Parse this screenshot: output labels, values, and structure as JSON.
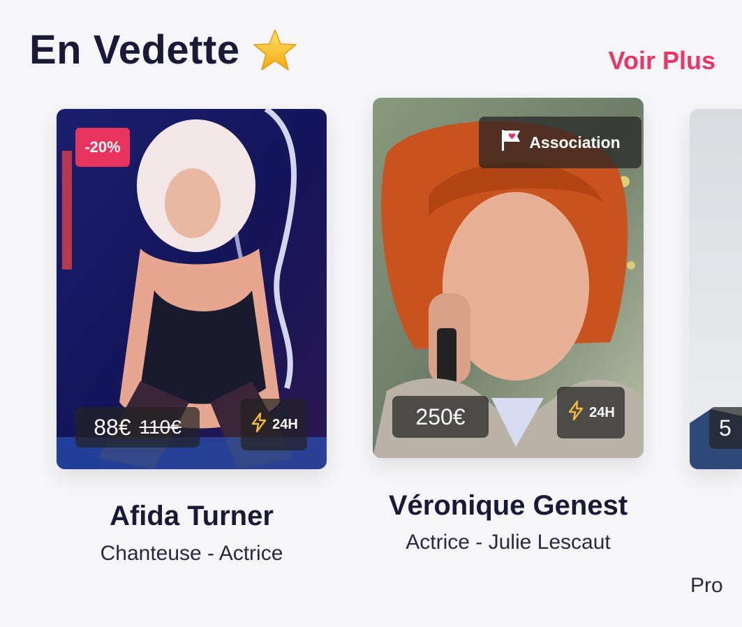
{
  "header": {
    "title": "En Vedette",
    "star_icon": "star-icon",
    "see_more": "Voir Plus"
  },
  "colors": {
    "accent": "#ea3566",
    "discount_bg": "#e8335f",
    "bolt": "#f5b93a",
    "title": "#1b1838"
  },
  "cards": [
    {
      "name": "Afida Turner",
      "role": "Chanteuse - Actrice",
      "discount": "-20%",
      "price": "88€",
      "old_price": "110€",
      "delivery": "24H"
    },
    {
      "name": "Véronique Genest",
      "role": "Actrice - Julie Lescaut",
      "tag": "Association",
      "price": "250€",
      "delivery": "24H"
    },
    {
      "price_partial": "5",
      "role_partial": "Pro"
    }
  ]
}
